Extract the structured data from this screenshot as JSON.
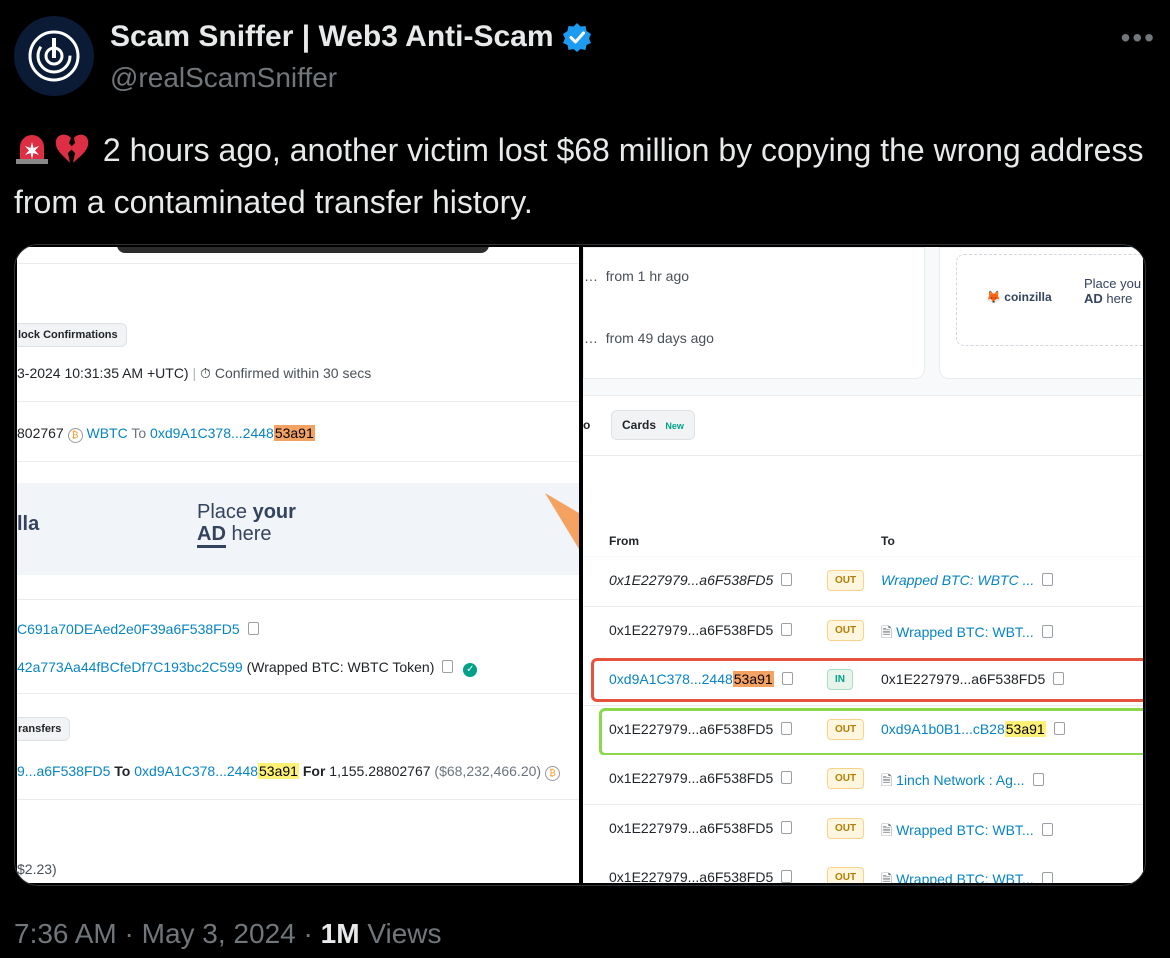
{
  "author": {
    "display_name": "Scam Sniffer | Web3 Anti-Scam",
    "handle": "@realScamSniffer"
  },
  "tweet": {
    "text": "2 hours ago, another victim lost $68 million by copying the wrong address from a contaminated transfer history.",
    "emojis": [
      "rotating-light-icon",
      "broken-heart-icon"
    ]
  },
  "footer": {
    "time": "7:36 AM",
    "date": "May 3, 2024",
    "views_count": "1M",
    "views_label": "Views"
  },
  "left_pane": {
    "block_confirmations": "lock Confirmations",
    "timestamp": "3-2024 10:31:35 AM +UTC)",
    "confirmed": "Confirmed within 30 secs",
    "transfer_amount": "802767",
    "token": "WBTC",
    "to_label": "To",
    "to_addr_prefix": "0xd9A1C378...2448",
    "to_addr_suffix": "53a91",
    "ad_brand": "lla",
    "ad_line1_a": "Place ",
    "ad_line1_b": "your",
    "ad_line2_a": "AD",
    "ad_line2_b": " here",
    "from_addr": "C691a70DEAed2e0F39a6F538FD5",
    "contract_addr": "42a773Aa44fBCfeDf7C193bc2C599",
    "contract_name": "(Wrapped BTC: WBTC Token)",
    "transfers_label": "ransfers",
    "transfer_from": "9...a6F538FD5",
    "transfer_to_label": "To",
    "transfer_to_prefix": "0xd9A1C378...2448",
    "transfer_to_suffix": "53a91",
    "for_label": "For",
    "for_amount": "1,155.28802767",
    "usd_value": "($68,232,466.20)",
    "bottom_value": "$2.23)"
  },
  "right_pane": {
    "from_1hr": "from 1 hr ago",
    "from_49d": "from 49 days ago",
    "coinzilla": "coinzilla",
    "ad_line1": "Place you",
    "ad_line2_a": "AD",
    "ad_line2_b": " here",
    "tab_partial": "o",
    "tab_cards": "Cards",
    "tab_new": "New",
    "col_from": "From",
    "col_to": "To",
    "rows": [
      {
        "from": "0x1E227979...a6F538FD5",
        "dir": "OUT",
        "to": "Wrapped BTC: WBTC ...",
        "to_pre": "",
        "to_hl": ""
      },
      {
        "from": "0x1E227979...a6F538FD5",
        "dir": "OUT",
        "to": "Wrapped BTC: WBT...",
        "to_pre": "",
        "to_hl": ""
      },
      {
        "from_pre": "0xd9A1C378...2448",
        "from_hl": "53a91",
        "dir": "IN",
        "to": "0x1E227979...a6F538FD5"
      },
      {
        "from": "0x1E227979...a6F538FD5",
        "dir": "OUT",
        "to_pre": "0xd9A1b0B1...cB28",
        "to_hl": "53a91"
      },
      {
        "from": "0x1E227979...a6F538FD5",
        "dir": "OUT",
        "to": "1inch Network : Ag..."
      },
      {
        "from": "0x1E227979...a6F538FD5",
        "dir": "OUT",
        "to": "Wrapped BTC: WBT..."
      },
      {
        "from": "0x1E227979...a6F538FD5",
        "dir": "OUT",
        "to": "Wrapped BTC: WBT..."
      }
    ]
  },
  "colors": {
    "verified_badge": "#1d9bf0",
    "highlight_orange": "#f4a261",
    "highlight_yellow": "#fff176",
    "red_box": "#e5533d",
    "green_box": "#8bd94a",
    "link": "#0784c3"
  }
}
